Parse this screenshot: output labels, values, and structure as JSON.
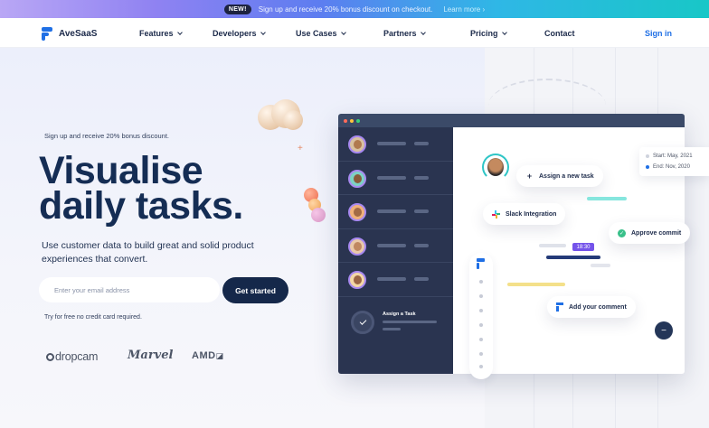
{
  "promo_banner": {
    "badge": "NEW!",
    "text": "Sign up and receive 20% bonus discount on checkout.",
    "link": "Learn more"
  },
  "nav": {
    "brand": "AveSaaS",
    "items": [
      {
        "label": "Features",
        "dropdown": true
      },
      {
        "label": "Developers",
        "dropdown": true
      },
      {
        "label": "Use Cases",
        "dropdown": true
      },
      {
        "label": "Partners",
        "dropdown": true
      },
      {
        "label": "Pricing",
        "dropdown": true
      },
      {
        "label": "Contact",
        "dropdown": false
      }
    ],
    "signin": "Sign in"
  },
  "hero": {
    "promo_line": "Sign up and receive 20% bonus discount.",
    "title_line1": "Visualise",
    "title_line2": "daily tasks.",
    "subcopy": "Use customer data to build great and solid product experiences that convert.",
    "email_placeholder": "Enter your email address",
    "cta": "Get started",
    "note": "Try for free no credit card required."
  },
  "partner_logos": [
    "dropcam",
    "Marvel",
    "AMD"
  ],
  "app_mock": {
    "assign_label": "Assign a Task",
    "cards": {
      "assign_new_task": "Assign a new task",
      "slack": "Slack Integration",
      "approve": "Approve commit",
      "comment": "Add your comment"
    },
    "dates": {
      "start": "Start: May, 2021",
      "end": "End: Nov, 2020"
    },
    "time_badge": "18:30",
    "fab_symbol": "−"
  },
  "colors": {
    "primary": "#15284a",
    "accent_blue": "#1f6fe5",
    "accent_teal": "#2ec5c6",
    "accent_purple": "#7453ea",
    "sidebar": "#2a3450"
  }
}
